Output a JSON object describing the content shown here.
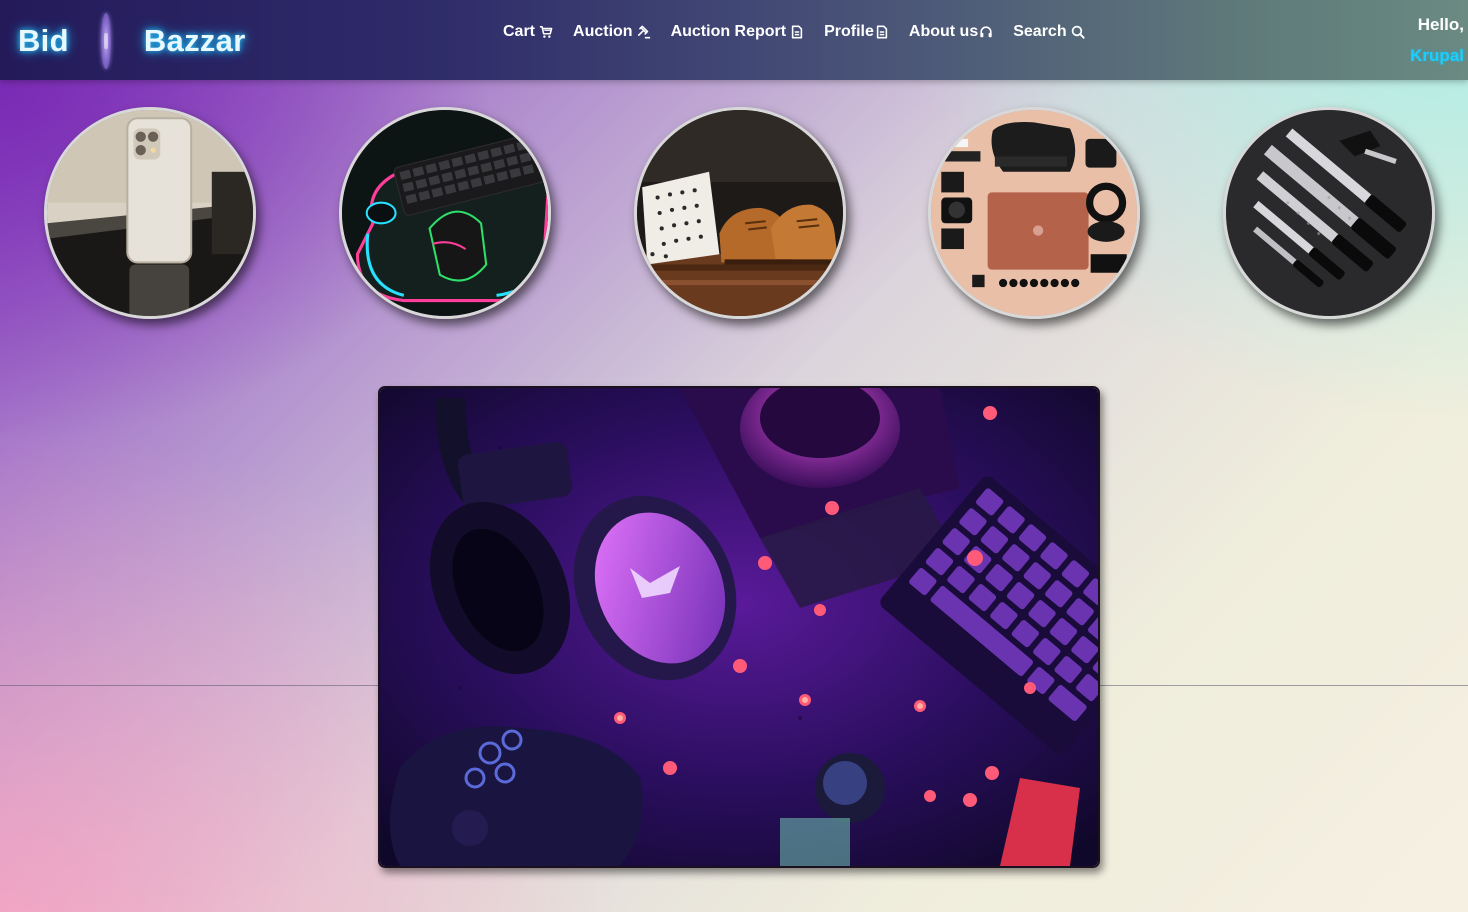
{
  "brand": {
    "left_word": "Bid",
    "right_word": "Bazzar",
    "logo_icon": "bid-logo-icon"
  },
  "nav": {
    "items": [
      {
        "label": "Cart",
        "icon": "cart-icon"
      },
      {
        "label": "Auction",
        "icon": "gavel-icon"
      },
      {
        "label": "Auction Report",
        "icon": "report-icon"
      },
      {
        "label": "Profile",
        "icon": "profile-doc-icon"
      },
      {
        "label": "About us",
        "icon": "headset-icon"
      },
      {
        "label": "Search",
        "icon": "search-icon"
      }
    ]
  },
  "user": {
    "greeting": "Hello,",
    "name": "Krupal"
  },
  "categories": [
    {
      "name": "smartphones",
      "image": "phone-image"
    },
    {
      "name": "gaming-accessories",
      "image": "keyboard-mouse-image"
    },
    {
      "name": "fashion",
      "image": "clothes-shoes-image"
    },
    {
      "name": "electronics-gadgets",
      "image": "gadgets-flatlay-image"
    },
    {
      "name": "kitchen-knives",
      "image": "knives-image"
    }
  ],
  "hero": {
    "image": "gaming-setup-hero-image"
  },
  "colors": {
    "brand_glow": "#25c8ff",
    "username": "#18d0ff",
    "nav_text": "#ffffff",
    "header_start": "#241a5a",
    "header_end": "#6a8a82"
  }
}
